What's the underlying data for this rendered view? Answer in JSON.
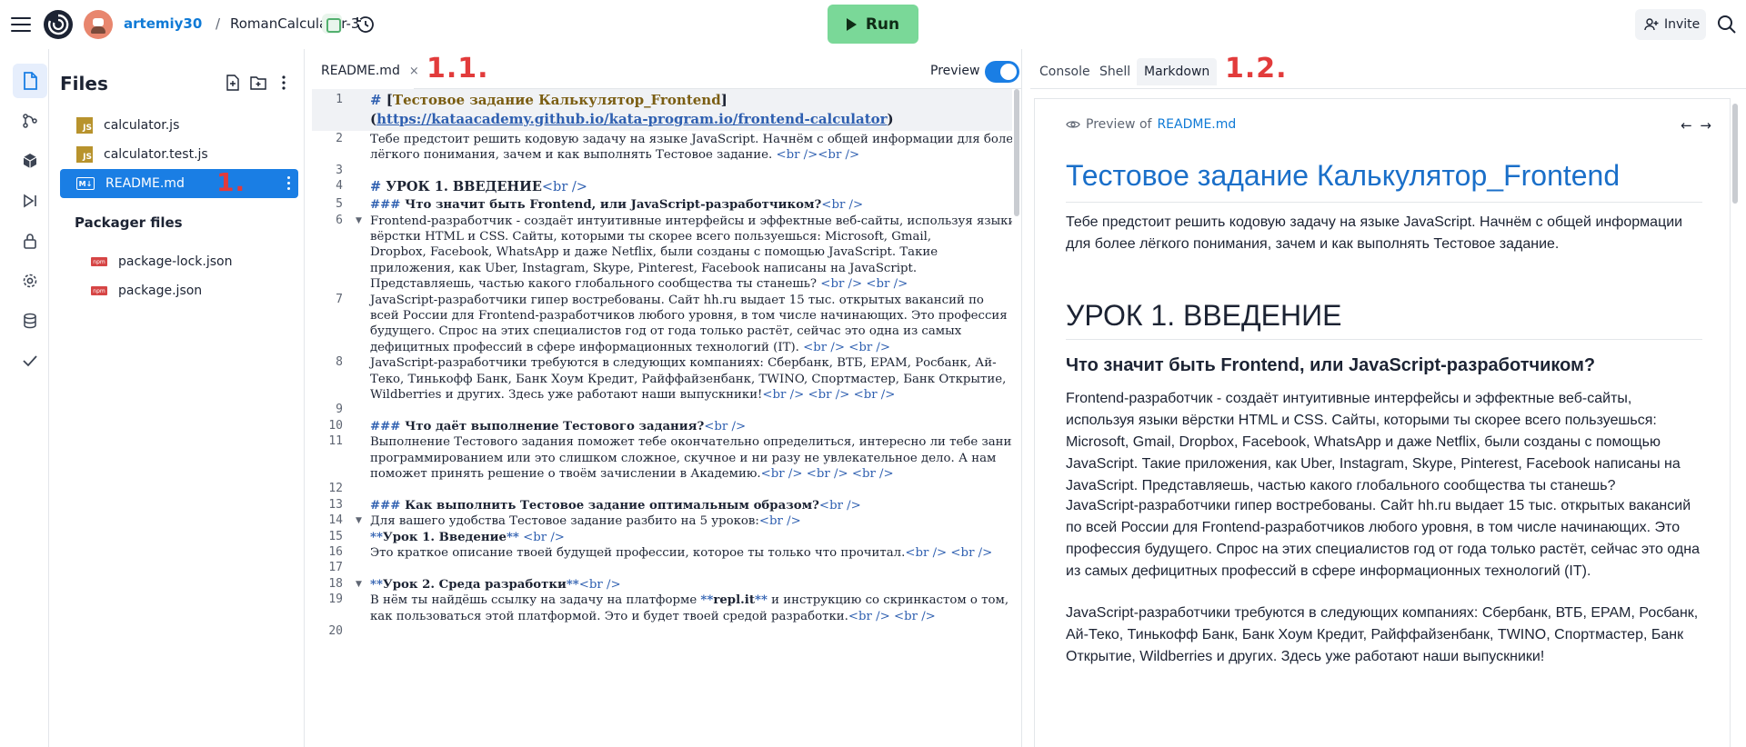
{
  "header": {
    "username": "artemiy30",
    "separator": "/",
    "repl_name": "RomanCalculator-3",
    "run_label": "Run",
    "invite_label": "Invite"
  },
  "files_panel": {
    "title": "Files",
    "files": [
      {
        "name": "calculator.js",
        "icon": "js-file-icon"
      },
      {
        "name": "calculator.test.js",
        "icon": "js-file-icon"
      },
      {
        "name": "README.md",
        "icon": "markdown-file-icon",
        "selected": true
      }
    ],
    "packager_title": "Packager files",
    "packager_files": [
      {
        "name": "package-lock.json",
        "icon": "package-file-icon"
      },
      {
        "name": "package.json",
        "icon": "package-file-icon"
      }
    ]
  },
  "annotations": {
    "a1": "1.",
    "a11": "1.1.",
    "a12": "1.2."
  },
  "editor": {
    "tab_name": "README.md",
    "tab_close": "×",
    "preview_label": "Preview",
    "preview_enabled": true,
    "lines": [
      {
        "n": "1",
        "parts": [
          [
            "hm",
            "# "
          ],
          [
            "h",
            "["
          ],
          [
            "linktxt h",
            "Тестовое задание Калькулятор_Frontend"
          ],
          [
            "h",
            "]"
          ]
        ],
        "cont": [
          [
            "h",
            "("
          ],
          [
            "lnk h",
            "https://kataacademy.github.io/kata-program.io/frontend-calculator"
          ],
          [
            "h",
            ")"
          ]
        ]
      },
      {
        "n": "2",
        "text": "Тебе предстоит решить кодовую задачу на языке JavaScript. Начнём с общей информации для более",
        "text2": "лёгкого понимания, зачем и как выполнять Тестовое задание.  ",
        "br2": "<br /><br />"
      },
      {
        "n": "3"
      },
      {
        "n": "4",
        "heading": "# ",
        "htext": "УРОК 1. ВВЕДЕНИЕ",
        "br": "<br />"
      },
      {
        "n": "5",
        "heading": "### ",
        "htext": "Что значит быть  Frontend, или JavaScript-разработчиком?",
        "br": "<br />"
      },
      {
        "n": "6",
        "fold": true,
        "wrap": [
          "Frontend-разработчик - создаёт интуитивные интерфейсы и эффектные веб-сайты, используя языки",
          "вёрстки HTML и CSS. Сайты, которыми ты скорее всего пользуешься: Microsoft, Gmail,",
          "Dropbox, Facebook, WhatsApp и даже Netflix, были созданы с помощью JavaScript. Такие",
          "приложения, как Uber, Instagram, Skype, Pinterest, Facebook написаны на JavaScript.",
          "Представляешь, частью какого глобального сообщества ты станешь?  "
        ],
        "br": "<br /> <br />"
      },
      {
        "n": "7",
        "wrap": [
          "JavaScript-разработчики гипер востребованы. Сайт hh.ru выдает 15 тыс. открытых вакансий по",
          "всей России для Frontend-разработчиков любого уровня, в том числе начинающих. Это профессия",
          "будущего. Спрос на этих специалистов год от года только растёт, сейчас это одна из самых",
          "дефицитных профессий в сфере информационных технологий (IT). "
        ],
        "br": "<br /> <br />"
      },
      {
        "n": "8",
        "wrap": [
          "JavaScript-разработчики требуются в следующих компаниях: Сбербанк, ВТБ, EPAM, Росбанк, Ай-",
          "Теко, Тинькофф Банк, Банк Хоум Кредит, Райффайзенбанк, TWINO, Спортмастер, Банк Открытие,",
          "Wildberries и других. Здесь уже работают наши выпускники!"
        ],
        "br": "<br /> <br /> <br />"
      },
      {
        "n": "9"
      },
      {
        "n": "10",
        "heading": "### ",
        "htext": "Что даёт выполнение Тестового задания?",
        "br": "<br />"
      },
      {
        "n": "11",
        "wrap": [
          "Выполнение Тестового задания поможет тебе окончательно определиться, интересно ли тебе заниматься",
          "программированием или это слишком сложное, скучное и ни разу не увлекательное дело. А нам",
          "поможет принять решение о твоём зачислении в Академию."
        ],
        "br": "<br /> <br /> <br />"
      },
      {
        "n": "12"
      },
      {
        "n": "13",
        "heading": "### ",
        "htext": "Как выполнить Тестовое задание оптимальным образом?",
        "br": "<br />"
      },
      {
        "n": "14",
        "fold": true,
        "text": "Для вашего удобства Тестовое задание разбито на 5 уроков:",
        "br": "<br />"
      },
      {
        "n": "15",
        "stars": "**",
        "htext": "Урок 1. Введение",
        "stars2": "**",
        "br": " <br />"
      },
      {
        "n": "16",
        "text": "Это краткое описание твоей будущей профессии, которое ты только что прочитал.",
        "br": "<br /> <br />"
      },
      {
        "n": "17"
      },
      {
        "n": "18",
        "fold": true,
        "stars": "**",
        "htext": "Урок 2. Среда разработки",
        "stars2": "**",
        "br": "<br />"
      },
      {
        "n": "19",
        "wrap19": true,
        "t1": "В нём ты найдёшь ссылку на задачу на платформе ",
        "b1": "**",
        "t2": "repl.it",
        "b2": "**",
        "t3": " и инструкцию со скринкастом о том,",
        "line2": "как пользоваться этой платформой. Это и будет твоей средой разработки.",
        "br": "<br /> <br />"
      },
      {
        "n": "20"
      }
    ]
  },
  "right_panel": {
    "tabs": [
      "Console",
      "Shell",
      "Markdown"
    ],
    "active_tab": "Markdown",
    "preview_of": "Preview of",
    "preview_file": "README.md",
    "nav_arrows": "← →",
    "h1": "Тестовое задание Калькулятор_Frontend",
    "intro": "Тебе предстоит решить кодовую задачу на языке JavaScript. Начнём с общей информации для более лёгкого понимания, зачем и как выполнять Тестовое задание.",
    "h2": "УРОК 1. ВВЕДЕНИЕ",
    "h3": "Что значит быть Frontend, или JavaScript-разработчиком?",
    "p1": "Frontend-разработчик - создаёт интуитивные интерфейсы и эффектные веб-сайты, используя языки вёрстки HTML и CSS. Сайты, которыми ты скорее всего пользуешься: Microsoft, Gmail, Dropbox, Facebook, WhatsApp и даже Netflix, были созданы с помощью JavaScript. Такие приложения, как Uber, Instagram, Skype, Pinterest, Facebook написаны на JavaScript. Представляешь, частью какого глобального сообщества ты станешь?",
    "p2": "JavaScript-разработчики гипер востребованы. Сайт hh.ru выдает 15 тыс. открытых вакансий по всей России для Frontend-разработчиков любого уровня, в том числе начинающих. Это профессия будущего. Спрос на этих специалистов год от года только растёт, сейчас это одна из самых дефицитных профессий в сфере информационных технологий (IT).",
    "p3": "JavaScript-разработчики требуются в следующих компаниях: Сбербанк, ВТБ, EPAM, Росбанк, Ай-Теко, Тинькофф Банк, Банк Хоум Кредит, Райффайзенбанк, TWINO, Спортмастер, Банк Открытие, Wildberries и других. Здесь уже работают наши выпускники!"
  },
  "colors": {
    "accent": "#1a7ee4",
    "run_button": "#7ad898",
    "annotation": "#e23b3b",
    "heading_blue": "#1a6fc9"
  }
}
